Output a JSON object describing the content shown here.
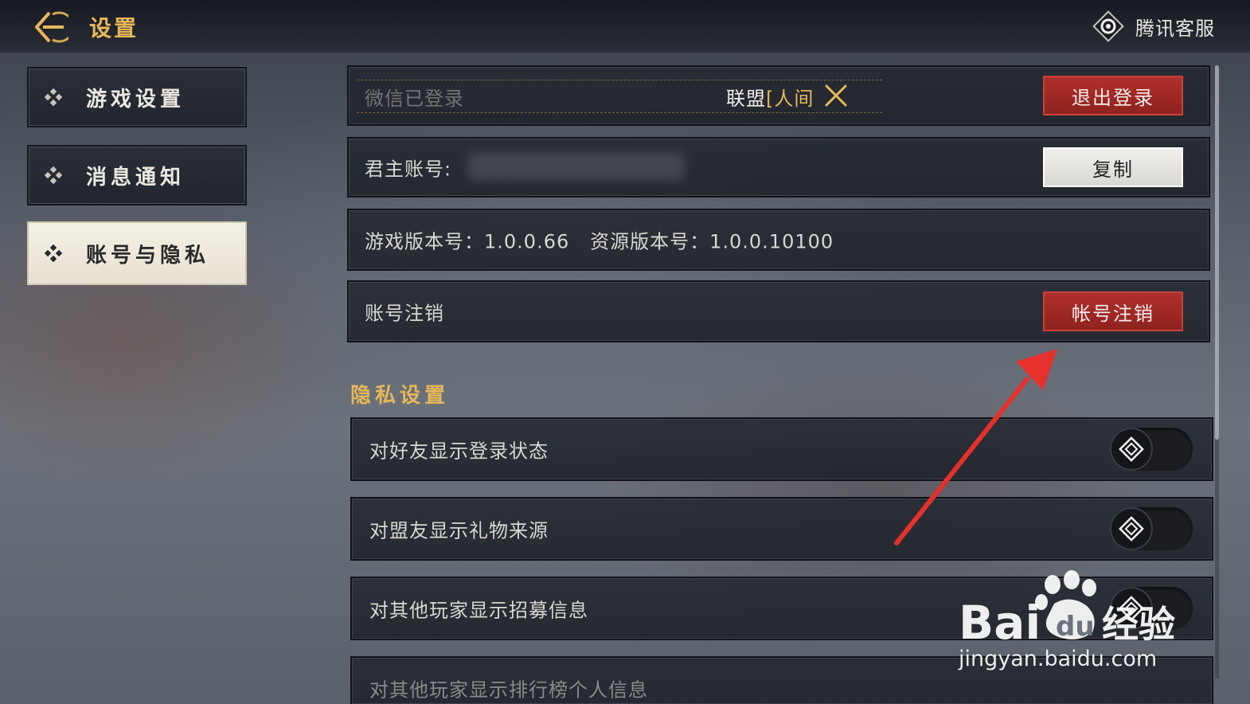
{
  "header": {
    "title": "设置",
    "service_label": "腾讯客服"
  },
  "sidebar": {
    "items": [
      {
        "label": "游戏设置",
        "active": false
      },
      {
        "label": "消息通知",
        "active": false
      },
      {
        "label": "账号与隐私",
        "active": true
      }
    ]
  },
  "account": {
    "wechat_status": "微信已登录",
    "alliance_prefix": "联盟",
    "alliance_name": "[人间",
    "logout_button": "退出登录",
    "lord_account_label": "君主账号:",
    "copy_button": "复制",
    "version_text": "游戏版本号：1.0.0.66   资源版本号：1.0.0.10100",
    "cancel_label": "账号注销",
    "cancel_button": "帐号注销"
  },
  "privacy": {
    "section_title": "隐私设置",
    "items": [
      {
        "label": "对好友显示登录状态",
        "enabled": false
      },
      {
        "label": "对盟友显示礼物来源",
        "enabled": false
      },
      {
        "label": "对其他玩家显示招募信息",
        "enabled": false
      },
      {
        "label": "对其他玩家显示排行榜个人信息",
        "enabled": false
      }
    ]
  },
  "watermark": {
    "brand": "Baidu经验",
    "url": "jingyan.baidu.com"
  },
  "colors": {
    "gold_accent": "#e6b75a",
    "danger_red": "#a82a26",
    "annotation_red": "#e5302c"
  }
}
